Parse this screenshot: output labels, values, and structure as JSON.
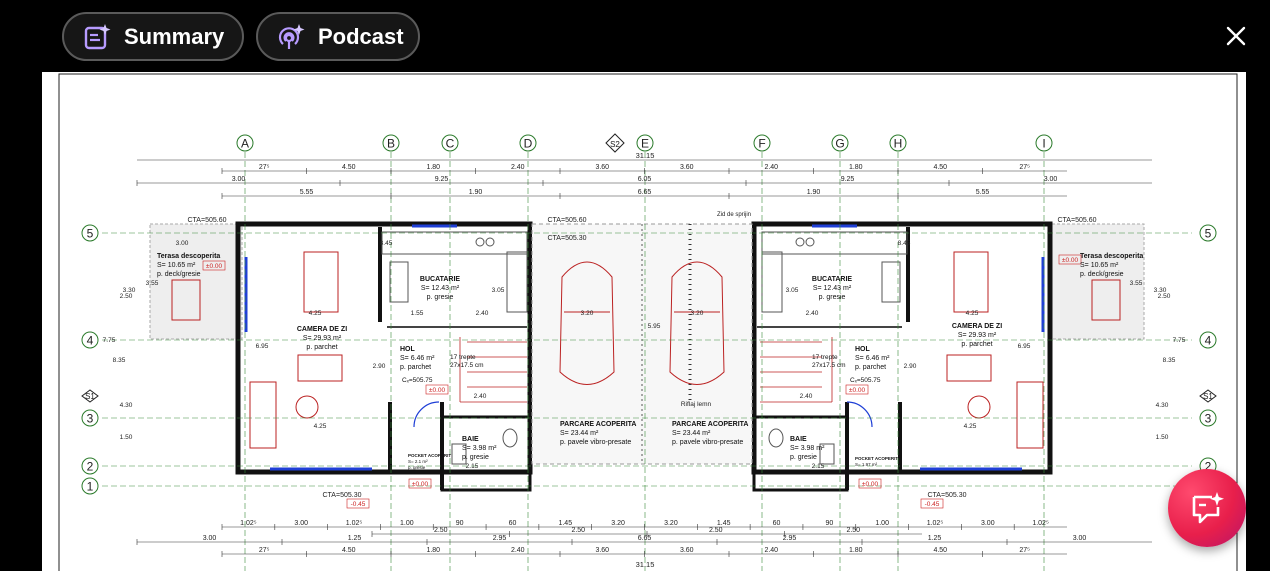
{
  "toolbar": {
    "summary_label": "Summary",
    "podcast_label": "Podcast",
    "summary_icon": "summary-sparkle-icon",
    "podcast_icon": "podcast-sparkle-icon",
    "close_icon": "close-icon"
  },
  "fab": {
    "icon": "ai-assistant-chat-icon",
    "color": "#e81f4b"
  },
  "drawing": {
    "axes_top": [
      "A",
      "B",
      "C",
      "D",
      "S2",
      "E",
      "F",
      "G",
      "H",
      "I"
    ],
    "axes_side": [
      "5",
      "4",
      "S1",
      "3",
      "2",
      "1"
    ],
    "top_dims_row1": [
      "27⁵",
      "4.50",
      "1.80",
      "2.40",
      "3.60",
      "3.60",
      "2.40",
      "1.80",
      "4.50",
      "27⁵"
    ],
    "top_dims_row2": [
      "3.00",
      "9.25",
      "6.05",
      "9.25",
      "3.00"
    ],
    "top_dims_row3": [
      "5.55",
      "1.90",
      "6.65",
      "1.90",
      "5.55"
    ],
    "total_width": "31.15",
    "total_width_bottom": "31.15",
    "bottom_dims_row1": [
      "1.02⁵",
      "3.00",
      "1.02⁵",
      "1.00",
      "90",
      "60",
      "1.45",
      "3.20",
      "3.20",
      "1.45",
      "60",
      "90",
      "1.00",
      "1.02⁵",
      "3.00",
      "1.02⁵"
    ],
    "bottom_dims_row2": [
      "2.50",
      "2.50",
      "2.50",
      "2.50"
    ],
    "bottom_dims_row3": [
      "3.00",
      "1.25",
      "2.95",
      "6.65",
      "2.95",
      "1.25",
      "3.00"
    ],
    "bottom_dims_row4": [
      "27⁵",
      "4.50",
      "1.80",
      "2.40",
      "3.60",
      "3.60",
      "2.40",
      "1.80",
      "4.50",
      "27⁵"
    ],
    "cta_labels": [
      "CTA=505.60",
      "CTA=505.60",
      "CTA=505.30",
      "CTA=505.60",
      "CTA=505.30",
      "CTA=505.30"
    ],
    "level_labels": [
      "±0.00",
      "±0.00",
      "±0.00",
      "±0.00",
      "-0.45",
      "-0.45",
      "±0.00",
      "±0.00"
    ],
    "wall_label": "Zid de sprijin",
    "fence_label": "Riflaj lemn",
    "rooms": [
      {
        "name": "Terasa descoperita",
        "area": "S=  10.65 m²",
        "finish": "p. deck/gresie"
      },
      {
        "name": "BUCATARIE",
        "area": "S=  12.43 m²",
        "finish": "p. gresie"
      },
      {
        "name": "CAMERA DE ZI",
        "area": "S=  29.93 m²",
        "finish": "p. parchet"
      },
      {
        "name": "HOL",
        "area": "S=  6.46 m²",
        "finish": "p. parchet"
      },
      {
        "name": "BAIE",
        "area": "S=  3.98 m²",
        "finish": "p. gresie"
      },
      {
        "name": "POCKET ACOPERIT",
        "area": "S=  2.1 m²",
        "finish": "p. gresie"
      },
      {
        "name": "PARCARE ACOPERITA",
        "area": "S=  23.44 m²",
        "finish": "p. pavele vibro-presate"
      },
      {
        "name": "PARCARE ACOPERITA",
        "area": "S=  23.44 m²",
        "finish": "p. pavele vibro-presate"
      },
      {
        "name": "BAIE",
        "area": "S=  3.98 m²",
        "finish": "p. gresie"
      },
      {
        "name": "HOL",
        "area": "S=  6.46 m²",
        "finish": "p. parchet"
      },
      {
        "name": "BUCATARIE",
        "area": "S=  12.43 m²",
        "finish": "p. gresie"
      },
      {
        "name": "CAMERA DE ZI",
        "area": "S=  29.93 m²",
        "finish": "p. parchet"
      },
      {
        "name": "Terasa descoperita",
        "area": "S=  10.65 m²",
        "finish": "p. deck/gresie"
      },
      {
        "name": "POCKET ACOPERIT",
        "area": "S=  1.97 m²",
        "finish": "p. gresie"
      }
    ],
    "stairs": [
      "17 trepte",
      "27x17.5 cm",
      "17 trepte",
      "27x17.5 cm"
    ],
    "stair_cota": [
      "Cₓ=505.75",
      "Cₓ=505.75"
    ],
    "inner_dims": [
      "8.45",
      "8.45",
      "3.00",
      "3.20",
      "3.20",
      "2.40",
      "2.40",
      "1.55",
      "4.25",
      "4.25",
      "4.25",
      "4.25",
      "2.15",
      "2.15",
      "2.40",
      "2.40",
      "5.95",
      "3.05",
      "3.05",
      "3.30",
      "3.30",
      "3.55",
      "3.55",
      "2.50",
      "2.50",
      "7.75",
      "7.75",
      "8.35",
      "8.35",
      "4.30",
      "4.30",
      "1.50",
      "1.50",
      "6.95",
      "6.95",
      "2.90",
      "2.90"
    ]
  }
}
